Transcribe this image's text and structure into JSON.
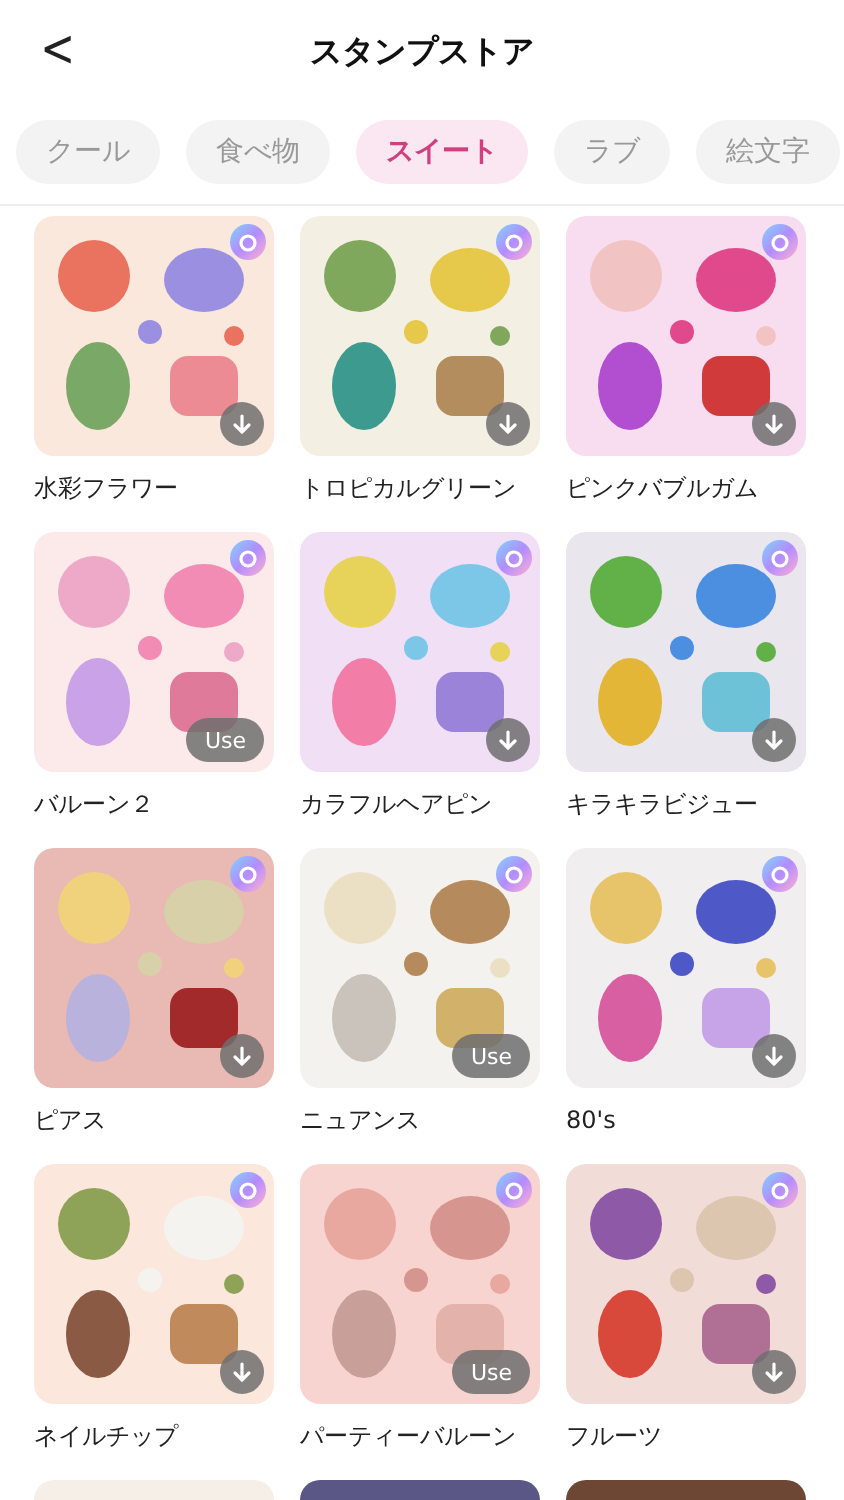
{
  "header": {
    "back": "<",
    "title": "スタンプストア"
  },
  "tabs": [
    {
      "label": "クール",
      "selected": false
    },
    {
      "label": "食べ物",
      "selected": false
    },
    {
      "label": "スイート",
      "selected": true
    },
    {
      "label": "ラブ",
      "selected": false
    },
    {
      "label": "絵文字",
      "selected": false
    }
  ],
  "stickers": [
    {
      "kind": "sticker",
      "name": "水彩フラワー",
      "action": {
        "kind": "download"
      }
    },
    {
      "kind": "sticker",
      "name": "トロピカルグリーン",
      "action": {
        "kind": "download"
      }
    },
    {
      "kind": "sticker",
      "name": "ピンクバブルガム",
      "action": {
        "kind": "download"
      }
    },
    {
      "kind": "sticker",
      "name": "バルーン２",
      "action": {
        "kind": "use",
        "label": "Use"
      }
    },
    {
      "kind": "sticker",
      "name": "カラフルヘアピン",
      "action": {
        "kind": "download"
      }
    },
    {
      "kind": "sticker",
      "name": "キラキラビジュー",
      "action": {
        "kind": "download"
      }
    },
    {
      "kind": "sticker",
      "name": "ピアス",
      "action": {
        "kind": "download"
      }
    },
    {
      "kind": "sticker",
      "name": "ニュアンス",
      "action": {
        "kind": "use",
        "label": "Use"
      }
    },
    {
      "kind": "sticker",
      "name": "80's",
      "action": {
        "kind": "download"
      }
    },
    {
      "kind": "sticker",
      "name": "ネイルチップ",
      "action": {
        "kind": "download"
      }
    },
    {
      "kind": "sticker",
      "name": "パーティーバルーン",
      "action": {
        "kind": "use",
        "label": "Use"
      }
    },
    {
      "kind": "sticker",
      "name": "フルーツ",
      "action": {
        "kind": "download"
      }
    },
    {
      "kind": "picture"
    },
    {
      "kind": "picture"
    },
    {
      "kind": "picture"
    }
  ]
}
